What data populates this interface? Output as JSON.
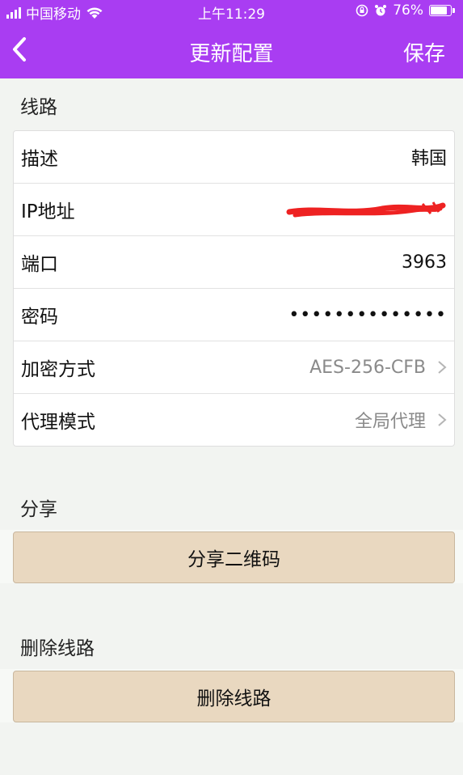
{
  "status_bar": {
    "carrier": "中国移动",
    "time": "上午11:29",
    "battery_percent": "76%",
    "battery_level": 0.76
  },
  "nav": {
    "title": "更新配置",
    "save_label": "保存",
    "back_icon": "chevron-left-icon"
  },
  "line_section": {
    "title": "线路",
    "rows": [
      {
        "label": "描述",
        "value": "韩国"
      },
      {
        "label": "IP地址",
        "value": ""
      },
      {
        "label": "端口",
        "value": "3963"
      },
      {
        "label": "密码",
        "value": "••••••••••••••"
      },
      {
        "label": "加密方式",
        "value": "AES-256-CFB"
      },
      {
        "label": "代理模式",
        "value": "全局代理"
      }
    ]
  },
  "share_section": {
    "title": "分享",
    "button_label": "分享二维码"
  },
  "delete_section": {
    "title": "删除线路",
    "button_label": "删除线路"
  },
  "colors": {
    "header": "#a93df2",
    "button_bg": "#e9d8c0",
    "redaction": "#ee2222"
  }
}
